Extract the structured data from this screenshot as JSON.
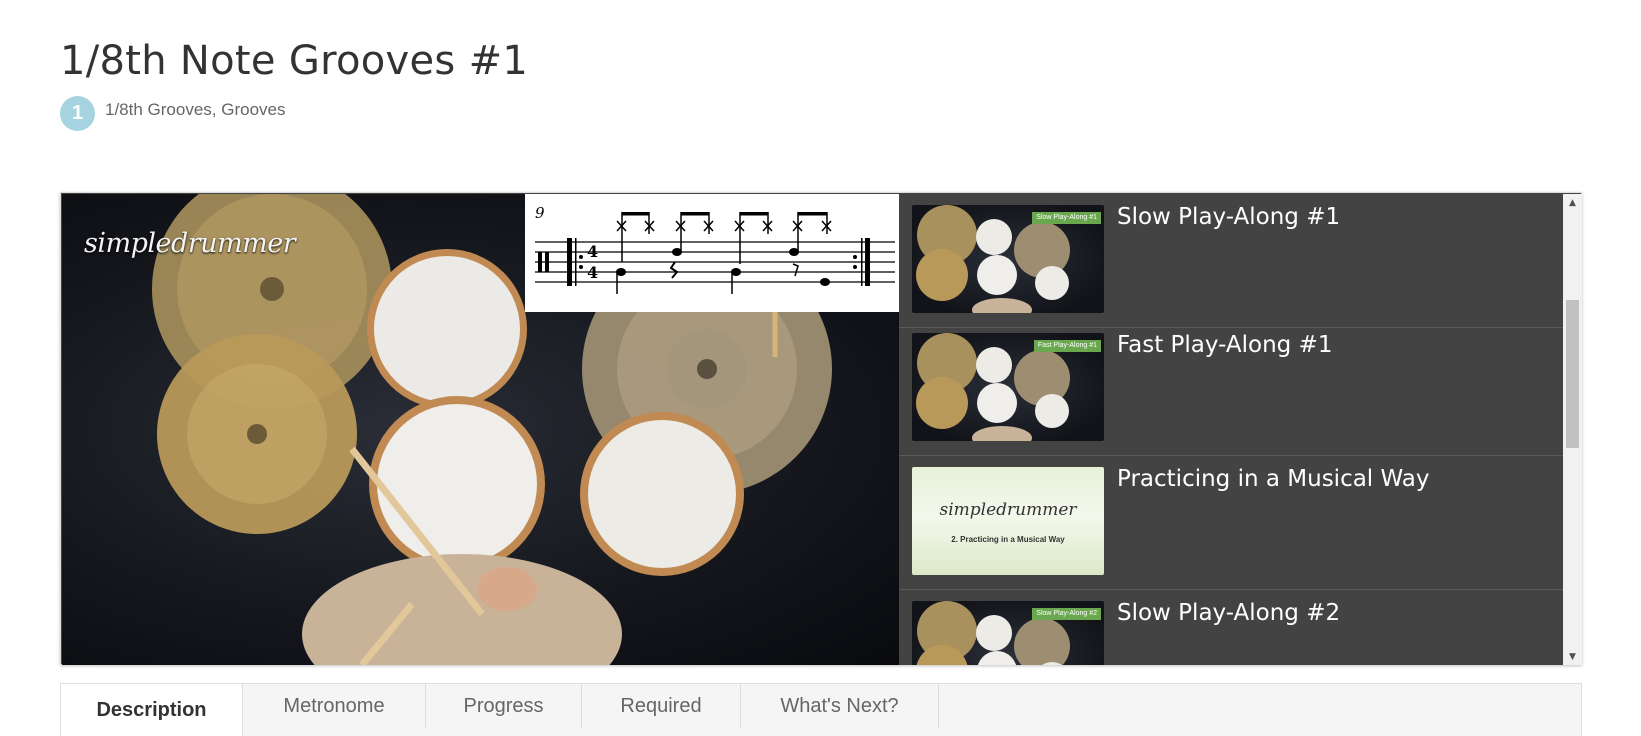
{
  "lesson": {
    "title": "1/8th Note Grooves #1",
    "level": "1",
    "categories": "1/8th Grooves, Grooves"
  },
  "video": {
    "brand": "simpledrummer",
    "bar_number": "9"
  },
  "playlist": {
    "items": [
      {
        "title": "Slow Play-Along #1",
        "thumb": "drum-overhead",
        "tag": "Slow Play-Along #1"
      },
      {
        "title": "Fast Play-Along #1",
        "thumb": "drum-overhead",
        "tag": "Fast Play-Along #1"
      },
      {
        "title": "Practicing in a Musical Way",
        "thumb": "title-card",
        "logo": "simpledrummer",
        "caption": "2. Practicing in a Musical Way"
      },
      {
        "title": "Slow Play-Along #2",
        "thumb": "drum-overhead",
        "tag": "Slow Play-Along #2"
      }
    ]
  },
  "tabs": [
    "Description",
    "Metronome",
    "Progress",
    "Required",
    "What's Next?"
  ],
  "active_tab": "Description",
  "colors": {
    "level_badge": "#a6d3e0",
    "playlist_bg": "#434343",
    "tag_green": "#6aa84f"
  }
}
